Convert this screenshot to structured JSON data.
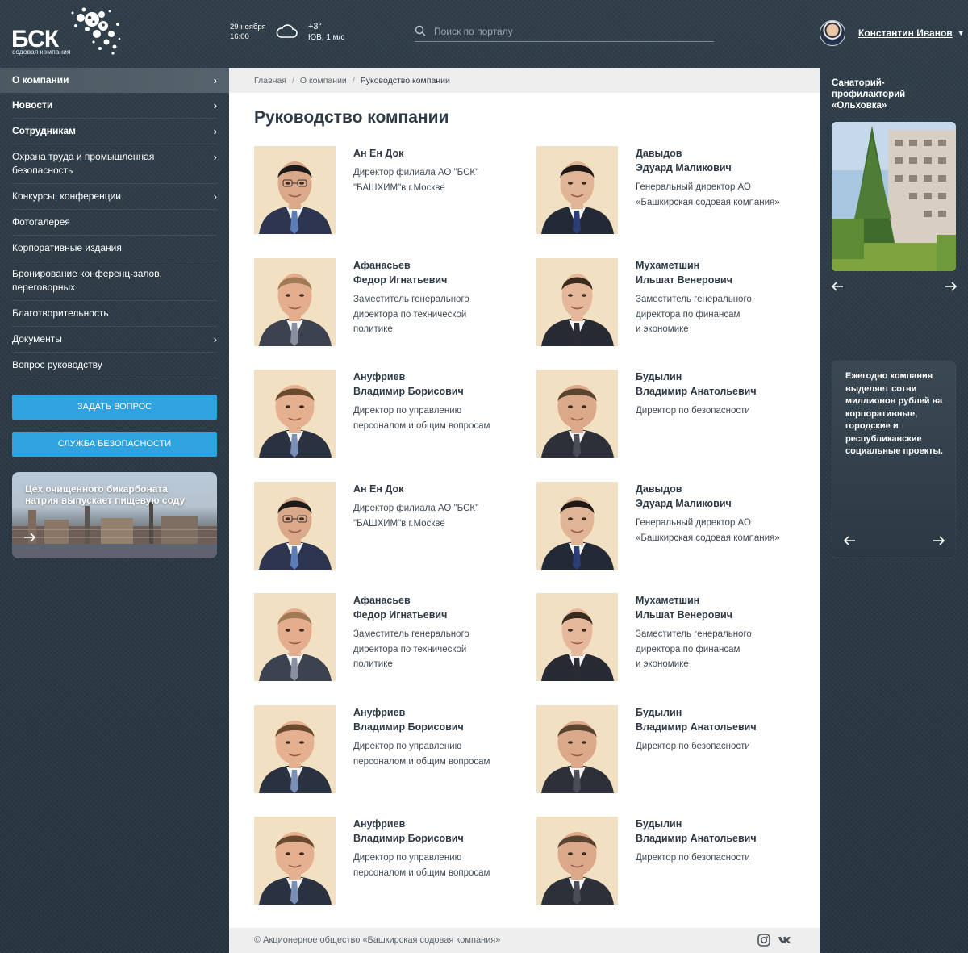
{
  "header": {
    "logo": {
      "title": "БСК",
      "subtitle": "содовая компания"
    },
    "date": {
      "day": "29 ноября",
      "time": "16:00"
    },
    "weather": {
      "temp": "+3°",
      "wind": "ЮВ, 1 м/с",
      "icon": "cloud-icon"
    },
    "search": {
      "placeholder": "Поиск по порталу",
      "value": ""
    },
    "user": {
      "name": "Константин Иванов"
    }
  },
  "sidebar": {
    "items": [
      {
        "label": "О компании",
        "chevron": true,
        "bold": true,
        "active": true
      },
      {
        "label": "Новости",
        "chevron": true,
        "bold": true
      },
      {
        "label": "Сотрудникам",
        "chevron": true,
        "bold": true
      },
      {
        "label": "Охрана труда и промышленная безопасность",
        "chevron": true
      },
      {
        "label": "Конкурсы, конференции",
        "chevron": true
      },
      {
        "label": "Фотогалерея",
        "chevron": false
      },
      {
        "label": "Корпоративные издания",
        "chevron": false
      },
      {
        "label": "Бронирование конференц-залов, переговорных",
        "chevron": false
      },
      {
        "label": "Благотворительность",
        "chevron": false
      },
      {
        "label": "Документы",
        "chevron": true
      },
      {
        "label": "Вопрос руководству",
        "chevron": false
      }
    ],
    "buttons": {
      "ask": "ЗАДАТЬ ВОПРОС",
      "security": "СЛУЖБА БЕЗОПАСНОСТИ"
    },
    "promo": {
      "text": "Цех очищенного бикарбоната натрия  выпускает пищевую соду"
    }
  },
  "breadcrumb": {
    "home": "Главная",
    "section": "О компании",
    "current": "Руководство компании"
  },
  "page": {
    "title": "Руководство компании"
  },
  "people": [
    {
      "surname": "Ан Ен Док",
      "name": "",
      "position": [
        "Директор филиала АО \"БСК\"",
        "\"БАШХИМ\"в г.Москве"
      ],
      "photo": "asian"
    },
    {
      "surname": "Давыдов",
      "name": "Эдуард Маликович",
      "position": [
        "Генеральный директор АО",
        "«Башкирская содовая компания»"
      ],
      "photo": "young"
    },
    {
      "surname": "Афанасьев",
      "name": "Федор Игнатьевич",
      "position": [
        "Заместитель генерального",
        "директора по технической",
        "политике"
      ],
      "photo": "older"
    },
    {
      "surname": "Мухаметшин",
      "name": "Ильшат Венерович",
      "position": [
        "Заместитель генерального",
        "директора по финансам",
        "и экономике"
      ],
      "photo": "slim"
    },
    {
      "surname": "Ануфриев",
      "name": "Владимир Борисович",
      "position": [
        "Директор по управлению",
        "персоналом и общим вопросам"
      ],
      "photo": "round"
    },
    {
      "surname": "Будылин",
      "name": "Владимир Анатольевич",
      "position": [
        "Директор по безопасности"
      ],
      "photo": "broad"
    },
    {
      "surname": "Ан Ен Док",
      "name": "",
      "position": [
        "Директор филиала АО \"БСК\"",
        "\"БАШХИМ\"в г.Москве"
      ],
      "photo": "asian"
    },
    {
      "surname": "Давыдов",
      "name": "Эдуард Маликович",
      "position": [
        "Генеральный директор АО",
        "«Башкирская содовая компания»"
      ],
      "photo": "young"
    },
    {
      "surname": "Афанасьев",
      "name": "Федор Игнатьевич",
      "position": [
        "Заместитель генерального",
        "директора по технической",
        "политике"
      ],
      "photo": "older"
    },
    {
      "surname": "Мухаметшин",
      "name": "Ильшат Венерович",
      "position": [
        "Заместитель генерального",
        "директора по финансам",
        "и экономике"
      ],
      "photo": "slim"
    },
    {
      "surname": "Ануфриев",
      "name": "Владимир Борисович",
      "position": [
        "Директор по управлению",
        "персоналом и общим вопросам"
      ],
      "photo": "round"
    },
    {
      "surname": "Будылин",
      "name": "Владимир Анатольевич",
      "position": [
        "Директор по безопасности"
      ],
      "photo": "broad"
    },
    {
      "surname": "Ануфриев",
      "name": "Владимир Борисович",
      "position": [
        "Директор по управлению",
        "персоналом и общим вопросам"
      ],
      "photo": "round"
    },
    {
      "surname": "Будылин",
      "name": "Владимир Анатольевич",
      "position": [
        "Директор по безопасности"
      ],
      "photo": "broad"
    }
  ],
  "footer": {
    "copyright": "© Акционерное общество «Башкирская содовая компания»",
    "social": [
      "instagram-icon",
      "vk-icon"
    ]
  },
  "right": {
    "promo_title": "Санаторий-профилакторий «Ольховка»",
    "card_text": "Ежегодно компания выделяет сотни миллионов рублей на корпоративные, городские и республиканские социальные проекты."
  },
  "colors": {
    "accent": "#2ea3df",
    "dark": "#2b3a44",
    "text": "#2d3a45"
  }
}
